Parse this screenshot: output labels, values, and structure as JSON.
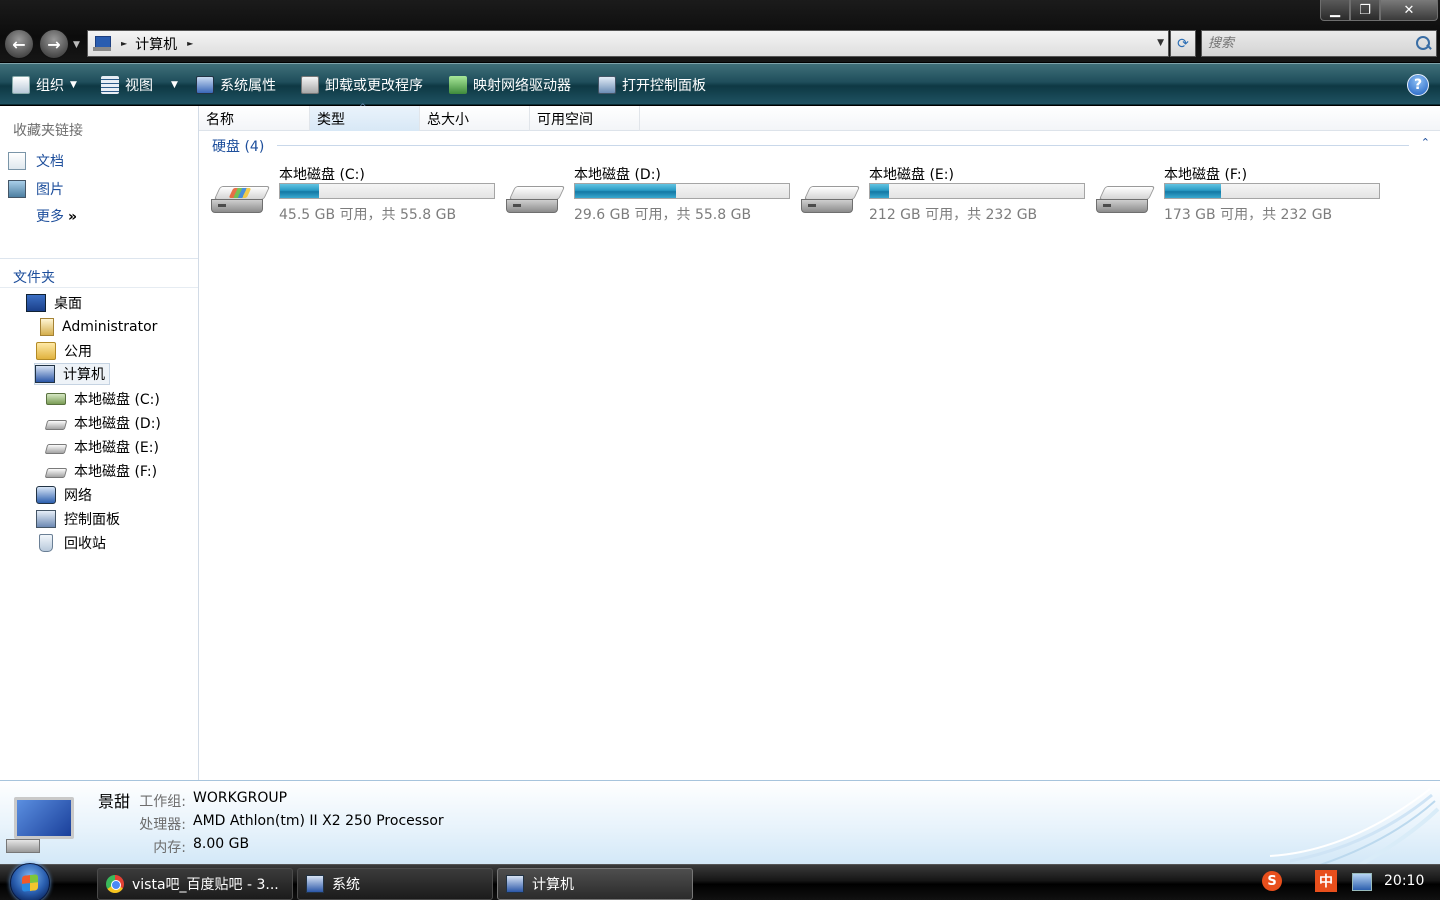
{
  "window": {
    "controls": {
      "minimize": "▁",
      "restore": "❐",
      "close": "✕"
    }
  },
  "address_bar": {
    "back_icon": "back-arrow-icon",
    "forward_icon": "forward-arrow-icon",
    "crumb_separator": "►",
    "location": "计算机",
    "refresh_icon": "refresh-icon",
    "search_placeholder": "搜索"
  },
  "toolbar": {
    "organize": "组织",
    "views": "视图",
    "system_properties": "系统属性",
    "uninstall": "卸载或更改程序",
    "map_drive": "映射网络驱动器",
    "control_panel": "打开控制面板",
    "help": "?"
  },
  "nav": {
    "favorites_header": "收藏夹链接",
    "favorites": [
      {
        "label": "文档",
        "icon": "documents-icon"
      },
      {
        "label": "图片",
        "icon": "pictures-icon"
      }
    ],
    "more": "更多",
    "more_chevron": "»",
    "folders_header": "文件夹",
    "folders_chevron": "⌄",
    "tree": [
      {
        "label": "桌面",
        "icon": "desktop-icon"
      },
      {
        "label": "Administrator",
        "icon": "user-folder-icon"
      },
      {
        "label": "公用",
        "icon": "folder-icon"
      },
      {
        "label": "计算机",
        "icon": "computer-icon",
        "selected": true
      },
      {
        "label": "本地磁盘 (C:)",
        "icon": "system-drive-icon"
      },
      {
        "label": "本地磁盘 (D:)",
        "icon": "drive-icon"
      },
      {
        "label": "本地磁盘 (E:)",
        "icon": "drive-icon"
      },
      {
        "label": "本地磁盘 (F:)",
        "icon": "drive-icon"
      },
      {
        "label": "网络",
        "icon": "network-icon"
      },
      {
        "label": "控制面板",
        "icon": "control-panel-icon"
      },
      {
        "label": "回收站",
        "icon": "recycle-bin-icon"
      }
    ]
  },
  "content": {
    "columns": [
      "名称",
      "类型",
      "总大小",
      "可用空间"
    ],
    "sorted_column": "类型",
    "sort_indicator": "^",
    "group_header": "硬盘 (4)",
    "group_chevron": "⌃",
    "drives": [
      {
        "name": "本地磁盘 (C:)",
        "info": "45.5 GB 可用，共 55.8 GB",
        "used_fraction": 0.18,
        "system": true
      },
      {
        "name": "本地磁盘 (D:)",
        "info": "29.6 GB 可用，共 55.8 GB",
        "used_fraction": 0.47,
        "system": false
      },
      {
        "name": "本地磁盘 (E:)",
        "info": "212 GB 可用，共 232 GB",
        "used_fraction": 0.09,
        "system": false
      },
      {
        "name": "本地磁盘 (F:)",
        "info": "173 GB 可用，共 232 GB",
        "used_fraction": 0.26,
        "system": false
      }
    ]
  },
  "details": {
    "computer_name": "景甜",
    "rows": [
      {
        "label": "工作组:",
        "value": "WORKGROUP"
      },
      {
        "label": "处理器:",
        "value": "AMD Athlon(tm) II X2 250 Processor"
      },
      {
        "label": "内存:",
        "value": "8.00 GB"
      }
    ]
  },
  "taskbar": {
    "tasks": [
      {
        "label": "vista吧_百度贴吧 - 3...",
        "icon": "chrome-icon",
        "active": false
      },
      {
        "label": "系统",
        "icon": "system-icon",
        "active": false
      },
      {
        "label": "计算机",
        "icon": "computer-icon",
        "active": true
      }
    ],
    "tray": {
      "sogou": "S",
      "ime": "中",
      "network_icon": "network-tray-icon"
    },
    "clock": "20:10"
  },
  "colors": {
    "toolbar_bg": "#1f4e5b",
    "link_blue": "#1e4f9c",
    "bar_fill": "#2a9bc5",
    "details_bg": "#e6f2fb"
  }
}
